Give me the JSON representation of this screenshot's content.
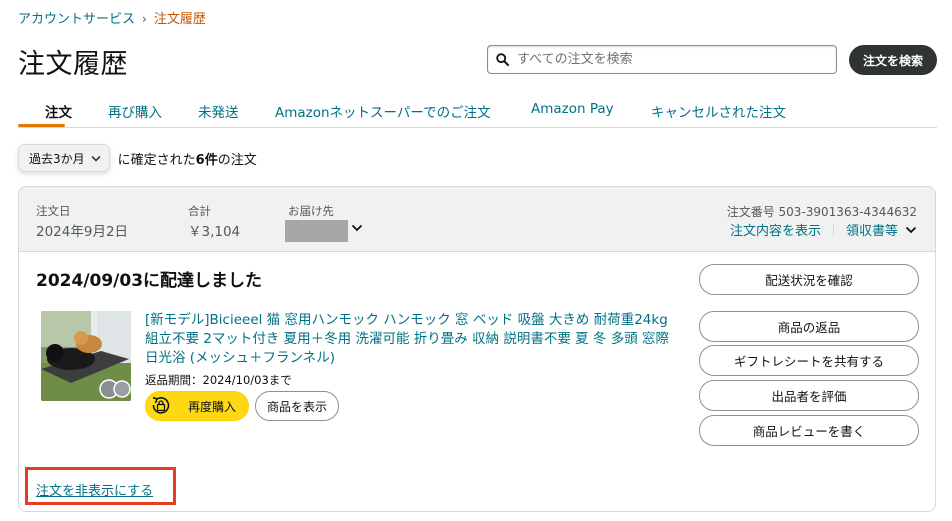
{
  "breadcrumb": {
    "parent": "アカウントサービス",
    "separator": "›",
    "current": "注文履歴"
  },
  "page_title": "注文履歴",
  "search": {
    "placeholder": "すべての注文を検索",
    "value": "",
    "button_label": "注文を検索"
  },
  "tabs": [
    {
      "label": "注文",
      "active": true
    },
    {
      "label": "再び購入"
    },
    {
      "label": "未発送"
    },
    {
      "label": "Amazonネットスーパーでのご注文"
    },
    {
      "label": "Amazon Pay"
    },
    {
      "label": "キャンセルされた注文"
    }
  ],
  "filter": {
    "selected": "過去3か月",
    "prefix": "に確定された",
    "count": "6件",
    "suffix": "の注文"
  },
  "order": {
    "date_label": "注文日",
    "date": "2024年9月2日",
    "total_label": "合計",
    "total": "￥3,104",
    "ship_to_label": "お届け先",
    "order_number": "注文番号 503-3901363-4344632",
    "details_link": "注文内容を表示",
    "receipt_link": "領収書等",
    "delivery_status": "2024/09/03に配達しました",
    "product_title": "[新モデル]Bicieeel 猫 窓用ハンモック ハンモック 窓 ベッド 吸盤 大きめ 耐荷重24kg 組立不要 2マット付き 夏用＋冬用 洗濯可能 折り畳み 収納 説明書不要 夏 冬 多頭 窓際 日光浴 (メッシュ＋フランネル)",
    "return_period": "返品期間：2024/10/03まで",
    "buy_again": "再度購入",
    "view_item": "商品を表示",
    "actions": [
      "配送状況を確認",
      "商品の返品",
      "ギフトレシートを共有する",
      "出品者を評価",
      "商品レビューを書く"
    ],
    "hide_order": "注文を非表示にする"
  },
  "colors": {
    "link": "#007185",
    "accent": "#e77600",
    "buy_again": "#ffd814",
    "highlight": "#e53d1f",
    "breadcrumb_current": "#c45500"
  }
}
